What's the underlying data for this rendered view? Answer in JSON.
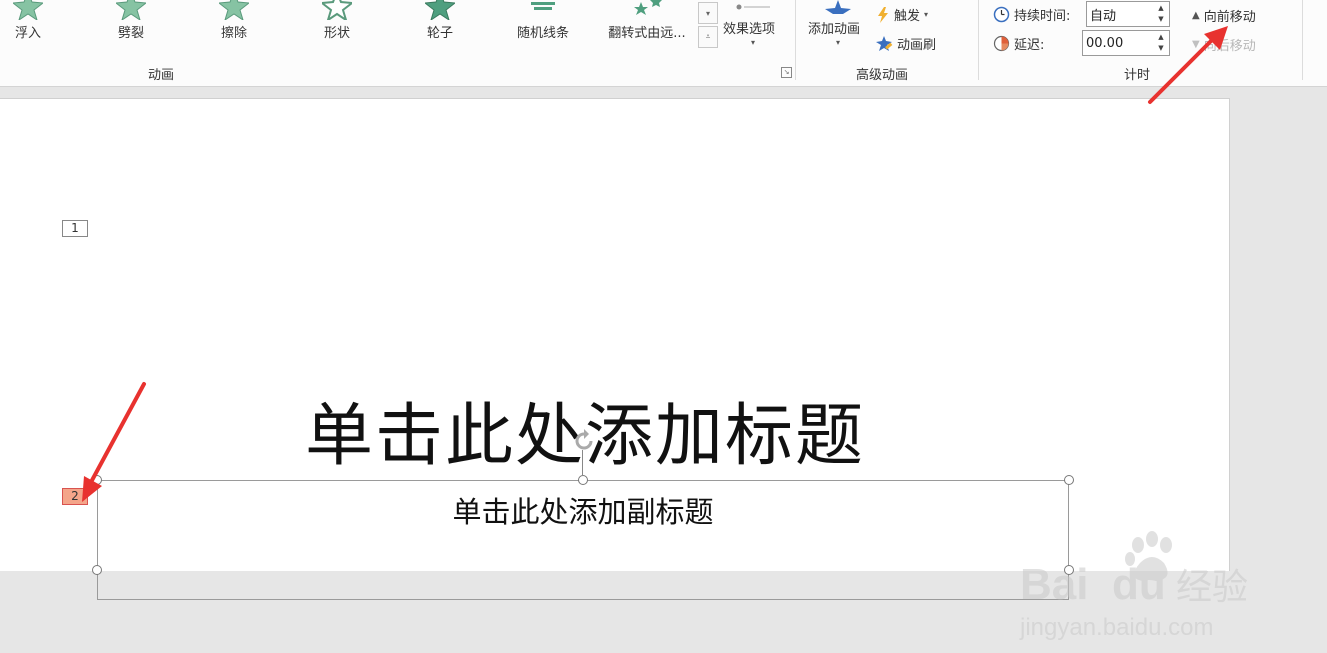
{
  "ribbon": {
    "animation_gallery": [
      {
        "label": "浮入",
        "color": "#7fbf9f"
      },
      {
        "label": "劈裂",
        "color": "#7fbf9f"
      },
      {
        "label": "擦除",
        "color": "#7fbf9f"
      },
      {
        "label": "形状",
        "color": "#7fbf9f"
      },
      {
        "label": "轮子",
        "color": "#4f9f7f"
      },
      {
        "label": "随机线条",
        "color": "#4f9f7f"
      },
      {
        "label": "翻转式由远...",
        "color": "#4f9f7f"
      }
    ],
    "effect_options_label": "效果选项",
    "animation_group_label": "动画",
    "add_animation_label": "添加动画",
    "trigger_label": "触发",
    "animation_painter_label": "动画刷",
    "advanced_group_label": "高级动画",
    "duration_label": "持续时间:",
    "duration_value": "自动",
    "delay_label": "延迟:",
    "delay_value": "00.00",
    "timing_group_label": "计时",
    "move_earlier_label": "向前移动",
    "move_later_label": "向后移动"
  },
  "slide": {
    "tag_1": "1",
    "tag_2": "2",
    "title_placeholder": "单击此处添加标题",
    "subtitle_placeholder": "单击此处添加副标题"
  },
  "watermark": {
    "brand": "Bai du 经验",
    "url": "jingyan.baidu.com"
  },
  "colors": {
    "arrow_red": "#e8322f",
    "tag2_fill": "#f4a58a",
    "tag2_border": "#d9534f"
  }
}
